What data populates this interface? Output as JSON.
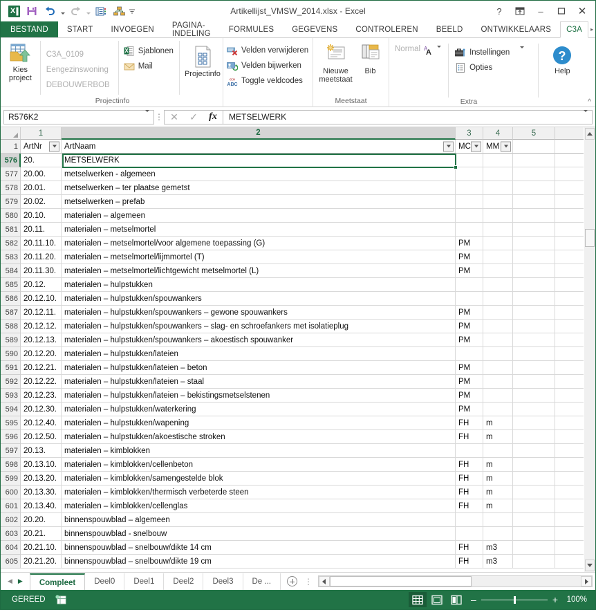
{
  "window": {
    "title": "Artikellijst_VMSW_2014.xlsx - Excel",
    "help_btn": "?",
    "ribbon_display_btn": "↑",
    "minimize_btn": "–",
    "restore_btn": "❐",
    "close_btn": "✕"
  },
  "quick_access": {
    "excel_logo": "excel-logo-icon",
    "save": "save-icon",
    "undo": "undo-icon",
    "redo": "redo-icon",
    "custom1": "list-icon",
    "custom2": "hierarchy-icon",
    "customize": "customize-qat-icon"
  },
  "ribbon_tabs": [
    {
      "label": "BESTAND",
      "type": "file"
    },
    {
      "label": "START",
      "type": "normal"
    },
    {
      "label": "INVOEGEN",
      "type": "normal"
    },
    {
      "label": "PAGINA-INDELING",
      "type": "normal"
    },
    {
      "label": "FORMULES",
      "type": "normal"
    },
    {
      "label": "GEGEVENS",
      "type": "normal"
    },
    {
      "label": "CONTROLEREN",
      "type": "normal"
    },
    {
      "label": "BEELD",
      "type": "normal"
    },
    {
      "label": "ONTWIKKELAARS",
      "type": "normal"
    },
    {
      "label": "C3A",
      "type": "active"
    }
  ],
  "ribbon": {
    "group_projectinfo": {
      "title": "Projectinfo",
      "kies_project": "Kies\nproject",
      "kies_project_line1": "Kies",
      "kies_project_line2": "project",
      "project_code": "C3A_0109",
      "project_type": "Eengezinswoning",
      "project_owner": "DEBOUWERBOB",
      "sjablonen": "Sjablonen",
      "mail": "Mail",
      "projectinfo_btn": "Projectinfo"
    },
    "group_velden": {
      "velden_verwijderen": "Velden verwijderen",
      "velden_bijwerken": "Velden bijwerken",
      "toggle_veldcodes": "Toggle veldcodes"
    },
    "group_meetstaat": {
      "title": "Meetstaat",
      "nieuwe_meetstaat_line1": "Nieuwe",
      "nieuwe_meetstaat_line2": "meetstaat",
      "bib": "Bib"
    },
    "group_extra": {
      "title": "Extra",
      "normal": "Normal",
      "instellingen": "Instellingen",
      "opties": "Opties",
      "help": "Help"
    },
    "collapse_ribbon": "^"
  },
  "formula_bar": {
    "name_box_value": "R576K2",
    "cancel_icon": "✕",
    "enter_icon": "✓",
    "fx_icon": "fx",
    "formula_value": "METSELWERK"
  },
  "grid": {
    "column_headers": [
      "1",
      "2",
      "3",
      "4",
      "5"
    ],
    "selected_column": "2",
    "filter_header": {
      "artnr": "ArtNr",
      "artnaam": "ArtNaam",
      "mc": "MC",
      "mm": "MM",
      "header_row_number": "1"
    },
    "selected_cell_row": "576",
    "rows": [
      {
        "n": "576",
        "artnr": "20.",
        "artnaam": "METSELWERK",
        "mc": "",
        "mm": ""
      },
      {
        "n": "577",
        "artnr": "20.00.",
        "artnaam": "metselwerken - algemeen",
        "mc": "",
        "mm": ""
      },
      {
        "n": "578",
        "artnr": "20.01.",
        "artnaam": "metselwerken – ter plaatse gemetst",
        "mc": "",
        "mm": ""
      },
      {
        "n": "579",
        "artnr": "20.02.",
        "artnaam": "metselwerken – prefab",
        "mc": "",
        "mm": ""
      },
      {
        "n": "580",
        "artnr": "20.10.",
        "artnaam": "materialen – algemeen",
        "mc": "",
        "mm": ""
      },
      {
        "n": "581",
        "artnr": "20.11.",
        "artnaam": "materialen – metselmortel",
        "mc": "",
        "mm": ""
      },
      {
        "n": "582",
        "artnr": "20.11.10.",
        "artnaam": "materialen – metselmortel/voor algemene toepassing (G)",
        "mc": "PM",
        "mm": ""
      },
      {
        "n": "583",
        "artnr": "20.11.20.",
        "artnaam": "materialen – metselmortel/lijmmortel (T)",
        "mc": "PM",
        "mm": ""
      },
      {
        "n": "584",
        "artnr": "20.11.30.",
        "artnaam": "materialen – metselmortel/lichtgewicht metselmortel (L)",
        "mc": "PM",
        "mm": ""
      },
      {
        "n": "585",
        "artnr": "20.12.",
        "artnaam": "materialen – hulpstukken",
        "mc": "",
        "mm": ""
      },
      {
        "n": "586",
        "artnr": "20.12.10.",
        "artnaam": "materialen – hulpstukken/spouwankers",
        "mc": "",
        "mm": ""
      },
      {
        "n": "587",
        "artnr": "20.12.11.",
        "artnaam": "materialen – hulpstukken/spouwankers – gewone spouwankers",
        "mc": "PM",
        "mm": ""
      },
      {
        "n": "588",
        "artnr": "20.12.12.",
        "artnaam": "materialen – hulpstukken/spouwankers – slag- en schroefankers met isolatieplug",
        "mc": "PM",
        "mm": ""
      },
      {
        "n": "589",
        "artnr": "20.12.13.",
        "artnaam": "materialen – hulpstukken/spouwankers – akoestisch spouwanker",
        "mc": "PM",
        "mm": ""
      },
      {
        "n": "590",
        "artnr": "20.12.20.",
        "artnaam": "materialen – hulpstukken/lateien",
        "mc": "",
        "mm": ""
      },
      {
        "n": "591",
        "artnr": "20.12.21.",
        "artnaam": "materialen – hulpstukken/lateien – beton",
        "mc": "PM",
        "mm": ""
      },
      {
        "n": "592",
        "artnr": "20.12.22.",
        "artnaam": "materialen – hulpstukken/lateien – staal",
        "mc": "PM",
        "mm": ""
      },
      {
        "n": "593",
        "artnr": "20.12.23.",
        "artnaam": "materialen – hulpstukken/lateien – bekistingsmetselstenen",
        "mc": "PM",
        "mm": ""
      },
      {
        "n": "594",
        "artnr": "20.12.30.",
        "artnaam": "materialen – hulpstukken/waterkering",
        "mc": "PM",
        "mm": ""
      },
      {
        "n": "595",
        "artnr": "20.12.40.",
        "artnaam": "materialen – hulpstukken/wapening",
        "mc": "FH",
        "mm": "m"
      },
      {
        "n": "596",
        "artnr": "20.12.50.",
        "artnaam": "materialen – hulpstukken/akoestische stroken",
        "mc": "FH",
        "mm": "m"
      },
      {
        "n": "597",
        "artnr": "20.13.",
        "artnaam": "materialen – kimblokken",
        "mc": "",
        "mm": ""
      },
      {
        "n": "598",
        "artnr": "20.13.10.",
        "artnaam": "materialen – kimblokken/cellenbeton",
        "mc": "FH",
        "mm": "m"
      },
      {
        "n": "599",
        "artnr": "20.13.20.",
        "artnaam": "materialen – kimblokken/samengestelde blok",
        "mc": "FH",
        "mm": "m"
      },
      {
        "n": "600",
        "artnr": "20.13.30.",
        "artnaam": "materialen – kimblokken/thermisch verbeterde steen",
        "mc": "FH",
        "mm": "m"
      },
      {
        "n": "601",
        "artnr": "20.13.40.",
        "artnaam": "materialen – kimblokken/cellenglas",
        "mc": "FH",
        "mm": "m"
      },
      {
        "n": "602",
        "artnr": "20.20.",
        "artnaam": "binnenspouwblad – algemeen",
        "mc": "",
        "mm": ""
      },
      {
        "n": "603",
        "artnr": "20.21.",
        "artnaam": "binnenspouwblad - snelbouw",
        "mc": "",
        "mm": ""
      },
      {
        "n": "604",
        "artnr": "20.21.10.",
        "artnaam": "binnenspouwblad – snelbouw/dikte 14 cm",
        "mc": "FH",
        "mm": "m3"
      },
      {
        "n": "605",
        "artnr": "20.21.20.",
        "artnaam": "binnenspouwblad – snelbouw/dikte 19 cm",
        "mc": "FH",
        "mm": "m3"
      }
    ]
  },
  "sheet_tabs": {
    "first_arrow": "◀",
    "next_arrow": "▶",
    "tabs": [
      {
        "label": "Compleet",
        "active": true
      },
      {
        "label": "Deel0",
        "active": false
      },
      {
        "label": "Deel1",
        "active": false
      },
      {
        "label": "Deel2",
        "active": false
      },
      {
        "label": "Deel3",
        "active": false
      },
      {
        "label": "De  ...",
        "active": false
      }
    ],
    "add_sheet": "new-sheet-icon",
    "overflow": "⋮"
  },
  "status_bar": {
    "state": "GEREED",
    "macro_icon": "record-macro-icon",
    "views": [
      {
        "name": "normal-view",
        "active": true
      },
      {
        "name": "page-layout-view",
        "active": false
      },
      {
        "name": "page-break-preview",
        "active": false
      }
    ],
    "zoom_out": "–",
    "zoom_in": "+",
    "zoom_level": "100%"
  },
  "colors": {
    "accent": "#217346",
    "file_tab": "#217346",
    "header_gray": "#f0f0f0",
    "grid_line": "#d9d9d9"
  }
}
